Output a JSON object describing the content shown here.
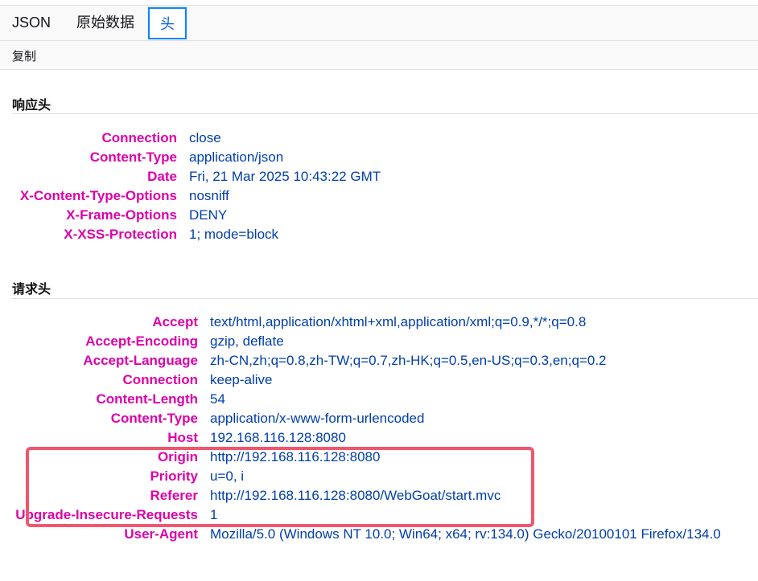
{
  "tabs": {
    "json": "JSON",
    "raw": "原始数据",
    "headers": "头"
  },
  "toolbar": {
    "copy": "复制"
  },
  "response": {
    "title": "响应头",
    "rows": [
      {
        "name": "Connection",
        "value": "close"
      },
      {
        "name": "Content-Type",
        "value": "application/json"
      },
      {
        "name": "Date",
        "value": "Fri, 21 Mar 2025 10:43:22 GMT"
      },
      {
        "name": "X-Content-Type-Options",
        "value": "nosniff"
      },
      {
        "name": "X-Frame-Options",
        "value": "DENY"
      },
      {
        "name": "X-XSS-Protection",
        "value": "1; mode=block"
      }
    ]
  },
  "request": {
    "title": "请求头",
    "rows": [
      {
        "name": "Accept",
        "value": "text/html,application/xhtml+xml,application/xml;q=0.9,*/*;q=0.8"
      },
      {
        "name": "Accept-Encoding",
        "value": "gzip, deflate"
      },
      {
        "name": "Accept-Language",
        "value": "zh-CN,zh;q=0.8,zh-TW;q=0.7,zh-HK;q=0.5,en-US;q=0.3,en;q=0.2"
      },
      {
        "name": "Connection",
        "value": "keep-alive"
      },
      {
        "name": "Content-Length",
        "value": "54"
      },
      {
        "name": "Content-Type",
        "value": "application/x-www-form-urlencoded"
      },
      {
        "name": "Host",
        "value": "192.168.116.128:8080"
      },
      {
        "name": "Origin",
        "value": "http://192.168.116.128:8080"
      },
      {
        "name": "Priority",
        "value": "u=0, i"
      },
      {
        "name": "Referer",
        "value": "http://192.168.116.128:8080/WebGoat/start.mvc"
      },
      {
        "name": "Upgrade-Insecure-Requests",
        "value": "1"
      },
      {
        "name": "User-Agent",
        "value": "Mozilla/5.0 (Windows NT 10.0; Win64; x64; rv:134.0) Gecko/20100101 Firefox/134.0"
      }
    ]
  },
  "colors": {
    "header_name": "#dd00a9",
    "header_value": "#003eaa",
    "active_tab_border": "#0b84ff",
    "highlight_box": "#f0566e"
  }
}
